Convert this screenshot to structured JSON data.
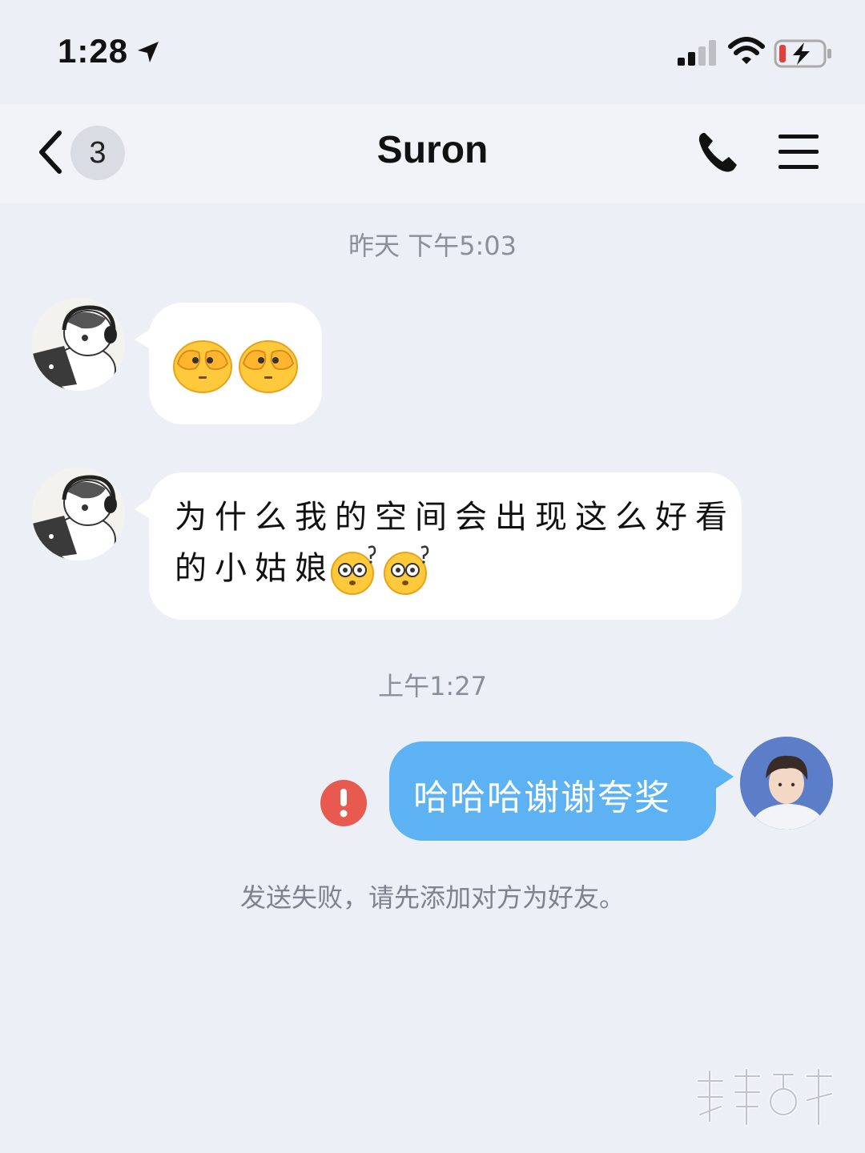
{
  "status_bar": {
    "time": "1:28",
    "icons": [
      "location-arrow-icon",
      "cellular-signal-icon",
      "wifi-icon",
      "battery-charging-icon"
    ]
  },
  "nav": {
    "back_icon": "chevron-left-icon",
    "unread_count": "3",
    "title": "Suron",
    "call_icon": "phone-icon",
    "menu_icon": "hamburger-menu-icon"
  },
  "messages": [
    {
      "timestamp": "昨天 下午5:03",
      "sender": "contact",
      "type": "sticker",
      "stickers": [
        "covering-eyes-emoji",
        "covering-eyes-emoji"
      ]
    },
    {
      "sender": "contact",
      "type": "text",
      "lines": [
        "为什么我的空间会出现这么好看",
        "的小姑娘"
      ],
      "trailing_stickers": [
        "confused-face-emoji",
        "confused-face-emoji"
      ]
    },
    {
      "timestamp": "上午1:27",
      "sender": "me",
      "type": "text",
      "text": "哈哈哈谢谢夸奖",
      "status": "failed",
      "status_icon": "exclamation-icon"
    }
  ],
  "system_note": "发送失败，请先添加对方为好友。",
  "watermark_text": "搜事百科",
  "colors": {
    "background": "#eceff6",
    "incoming_bubble": "#ffffff",
    "outgoing_bubble": "#5db2f4",
    "error": "#e85a4f"
  }
}
